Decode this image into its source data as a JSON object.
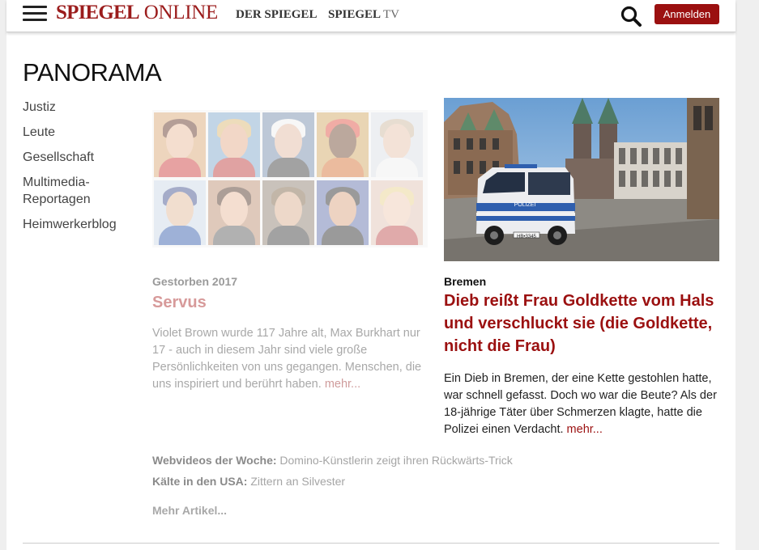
{
  "header": {
    "logo_bold": "SPIEGEL",
    "logo_light": "ONLINE",
    "nav_derspiegel": "DER SPIEGEL",
    "nav_spiegeltv_bold": "SPIEGEL",
    "nav_spiegeltv_light": "TV",
    "login_label": "Anmelden"
  },
  "section": {
    "title": "PANORAMA",
    "subnav": [
      "Justiz",
      "Leute",
      "Gesellschaft",
      "Multimedia-Reportagen",
      "Heimwerkerblog"
    ]
  },
  "left_teaser": {
    "kicker": "Gestorben 2017",
    "headline": "Servus",
    "text": "Violet Brown wurde 117 Jahre alt, Max Burkhart nur 17 - auch in diesem Jahr sind viele große Persönlichkeiten von uns gegangen. Menschen, die uns inspiriert und berührt haben.",
    "more": "mehr..."
  },
  "right_teaser": {
    "kicker": "Bremen",
    "headline": "Dieb reißt Frau Goldkette vom Hals und verschluckt sie (die Goldkette, nicht die Frau)",
    "text": "Ein Dieb in Bremen, der eine Kette gestohlen hatte, war schnell gefasst. Doch wo war die Beute? Als der 18-jährige Täter über Schmerzen klagte, hatte die Polizei einen Verdacht.",
    "more": "mehr...",
    "photo_van_label": "POLIZEI"
  },
  "extras": [
    {
      "label": "Webvideos der Woche:",
      "text": "Domino-Künstlerin zeigt ihren Rückwärts-Trick"
    },
    {
      "label": "Kälte in den USA:",
      "text": "Zittern an Silvester"
    }
  ],
  "more_articles": "Mehr Artikel...",
  "colors": {
    "brand_red": "#9b1010",
    "header_border": "#cfcfcf"
  }
}
